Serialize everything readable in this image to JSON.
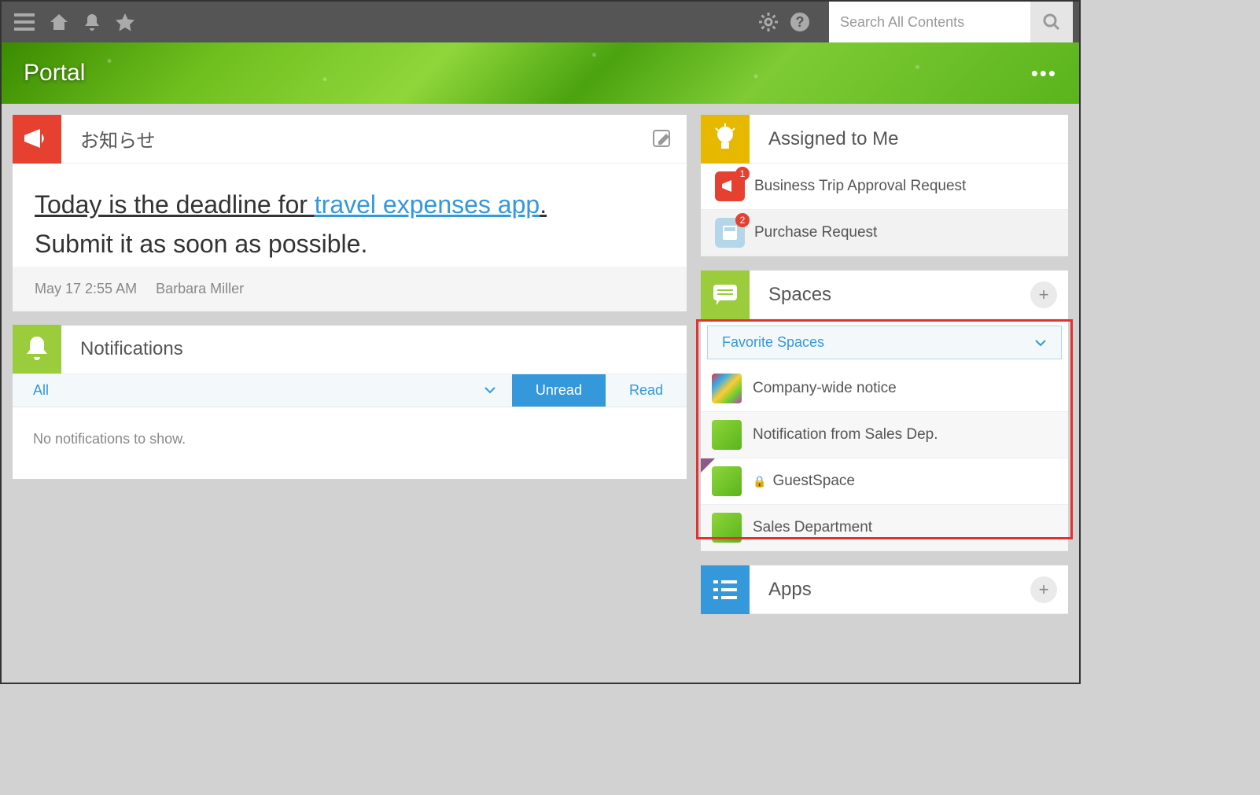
{
  "topbar": {
    "search_placeholder": "Search All Contents"
  },
  "banner": {
    "title": "Portal"
  },
  "announcements": {
    "title": "お知らせ",
    "headline_prefix": "Today is the deadline for ",
    "headline_link": "travel expenses app",
    "headline_suffix": ".",
    "subline": "Submit it as soon as possible.",
    "timestamp": "May 17 2:55 AM",
    "author": "Barbara Miller"
  },
  "notifications": {
    "title": "Notifications",
    "tabs": {
      "all": "All",
      "unread": "Unread",
      "read": "Read"
    },
    "empty": "No notifications to show."
  },
  "assigned": {
    "title": "Assigned to Me",
    "items": [
      {
        "label": "Business Trip Approval Request",
        "badge": "1",
        "color": "#e64030"
      },
      {
        "label": "Purchase Request",
        "badge": "2",
        "color": "#b3d7e8"
      }
    ]
  },
  "spaces": {
    "title": "Spaces",
    "dropdown": "Favorite Spaces",
    "items": [
      {
        "label": "Company-wide notice",
        "thumb": "pencils",
        "locked": false,
        "corner": false
      },
      {
        "label": "Notification from Sales Dep.",
        "thumb": "green",
        "locked": false,
        "corner": false
      },
      {
        "label": "GuestSpace",
        "thumb": "green",
        "locked": true,
        "corner": true
      },
      {
        "label": "Sales Department",
        "thumb": "green",
        "locked": false,
        "corner": false
      }
    ]
  },
  "apps": {
    "title": "Apps"
  }
}
